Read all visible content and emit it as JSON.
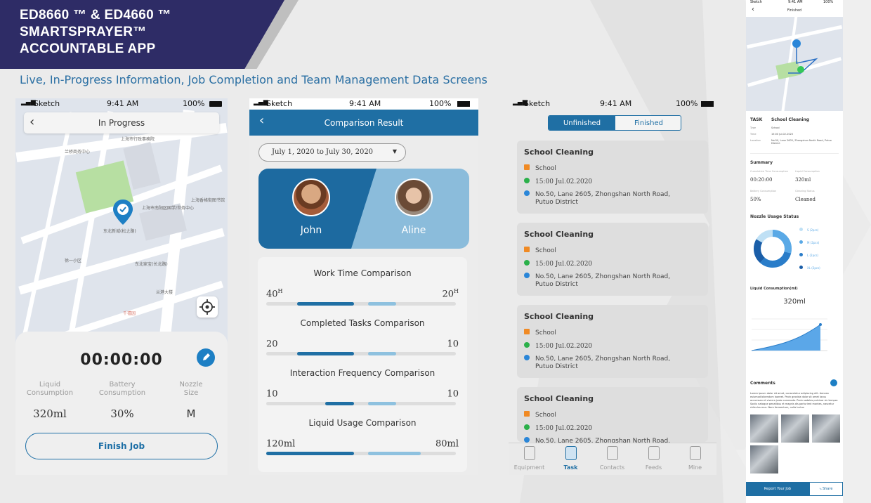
{
  "header": {
    "title_line1": "ED8660 ™ & ED4660 ™",
    "title_line2": "SMARTSPRAYER™",
    "title_line3": "ACCOUNTABLE APP",
    "subtitle": "Live, In-Progress Information, Job Completion  and Team Management Data Screens"
  },
  "status": {
    "carrier": "Sketch",
    "time": "9:41 AM",
    "battery": "100%"
  },
  "screen1": {
    "title": "In Progress",
    "timer": "00:00:00",
    "stats": [
      {
        "label": "Liquid Consumption",
        "value": "320ml"
      },
      {
        "label": "Battery Consumption",
        "value": "30%"
      },
      {
        "label": "Nozzle Size",
        "value": "M"
      }
    ],
    "finish_button": "Finish Job",
    "map_labels": [
      "上海市行政事務院",
      "兰桥商务中心",
      "上海香格街图书馆",
      "上海市南阳区国学/世务中心",
      "东北新城(松之路)",
      "徐一小区",
      "东北家宝(长北路)",
      "兰港大楼",
      "千禧园"
    ]
  },
  "screen2": {
    "title": "Comparison Result",
    "date_range": "July 1, 2020 to July 30, 2020",
    "user_a": "John",
    "user_b": "Aline",
    "comparisons": [
      {
        "title": "Work Time Comparison",
        "left": "40",
        "right": "20",
        "left_sup": "H",
        "right_sup": "H",
        "left_frac": 0.65,
        "right_frac": 0.32
      },
      {
        "title": "Completed Tasks Comparison",
        "left": "20",
        "right": "10",
        "left_sup": "",
        "right_sup": "",
        "left_frac": 0.65,
        "right_frac": 0.32
      },
      {
        "title": "Interaction Frequency Comparison",
        "left": "10",
        "right": "10",
        "left_sup": "",
        "right_sup": "",
        "left_frac": 0.33,
        "right_frac": 0.32
      },
      {
        "title": "Liquid Usage Comparison",
        "left": "120ml",
        "right": "80ml",
        "left_sup": "",
        "right_sup": "",
        "left_frac": 1.0,
        "right_frac": 0.6
      }
    ]
  },
  "screen3": {
    "tabs": [
      "Unfinished",
      "Finished"
    ],
    "tasks": [
      {
        "title": "School Cleaning",
        "type": "School",
        "time": "15:00  Jul.02.2020",
        "address": "No.50, Lane 2605, Zhongshan North Road, Putuo District"
      },
      {
        "title": "School Cleaning",
        "type": "School",
        "time": "15:00  Jul.02.2020",
        "address": "No.50, Lane 2605, Zhongshan North Road, Putuo District"
      },
      {
        "title": "School Cleaning",
        "type": "School",
        "time": "15:00  Jul.02.2020",
        "address": "No.50, Lane 2605, Zhongshan North Road, Putuo District"
      },
      {
        "title": "School Cleaning",
        "type": "School",
        "time": "15:00  Jul.02.2020",
        "address": "No.50, Lane 2605, Zhongshan North Road."
      }
    ],
    "nav": [
      "Equipment",
      "Task",
      "Contacts",
      "Feeds",
      "Mine"
    ]
  },
  "screen4": {
    "status_time": "9:41 AM",
    "title": "Finished",
    "task_label": "TASK",
    "task_name": "School Cleaning",
    "details": [
      {
        "k": "Type",
        "v": "School"
      },
      {
        "k": "Time",
        "v": "15:00  Jul.02.2020"
      },
      {
        "k": "Location",
        "v": "No.50, Lane 2605, Zhongshan North Road, Putuo District"
      }
    ],
    "summary_title": "Summary",
    "summary": [
      {
        "k": "Cumulative Time Consumption",
        "v": "00:20:00"
      },
      {
        "k": "Liquid Consumption",
        "v": "320ml"
      },
      {
        "k": "Battery Consumption",
        "v": "50%"
      },
      {
        "k": "Cleaning Status",
        "v": "Cleaned"
      }
    ],
    "nozzle_title": "Nozzle Usage Status",
    "nozzle_legend": [
      "S (2pcs)",
      "M (2pcs)",
      "L (2pcs)",
      "XL (2pcs)"
    ],
    "liquid_title": "Liquid Consumption(ml)",
    "liquid_value": "320ml",
    "comments_title": "Comments",
    "comments_text": "Lorem ipsum dolor sit amet, consectetur adipiscing elit. Aenean euismod bibendum laoreet. Proin gravida dolor sit amet lacus accumsan et viverra justo commodo. Proin sodales pulvinar sic tempor. Sociis natoque penatibus et magnis dis parturient montes, nascetur ridiculus mus. Nam fermentum, nulla luctus",
    "report_button": "Report Your Job",
    "share_button": "Share"
  },
  "colors": {
    "navy": "#2e2c66",
    "primary": "#1f6fa4",
    "light": "#8ec1df",
    "accent_green": "#34c759"
  }
}
